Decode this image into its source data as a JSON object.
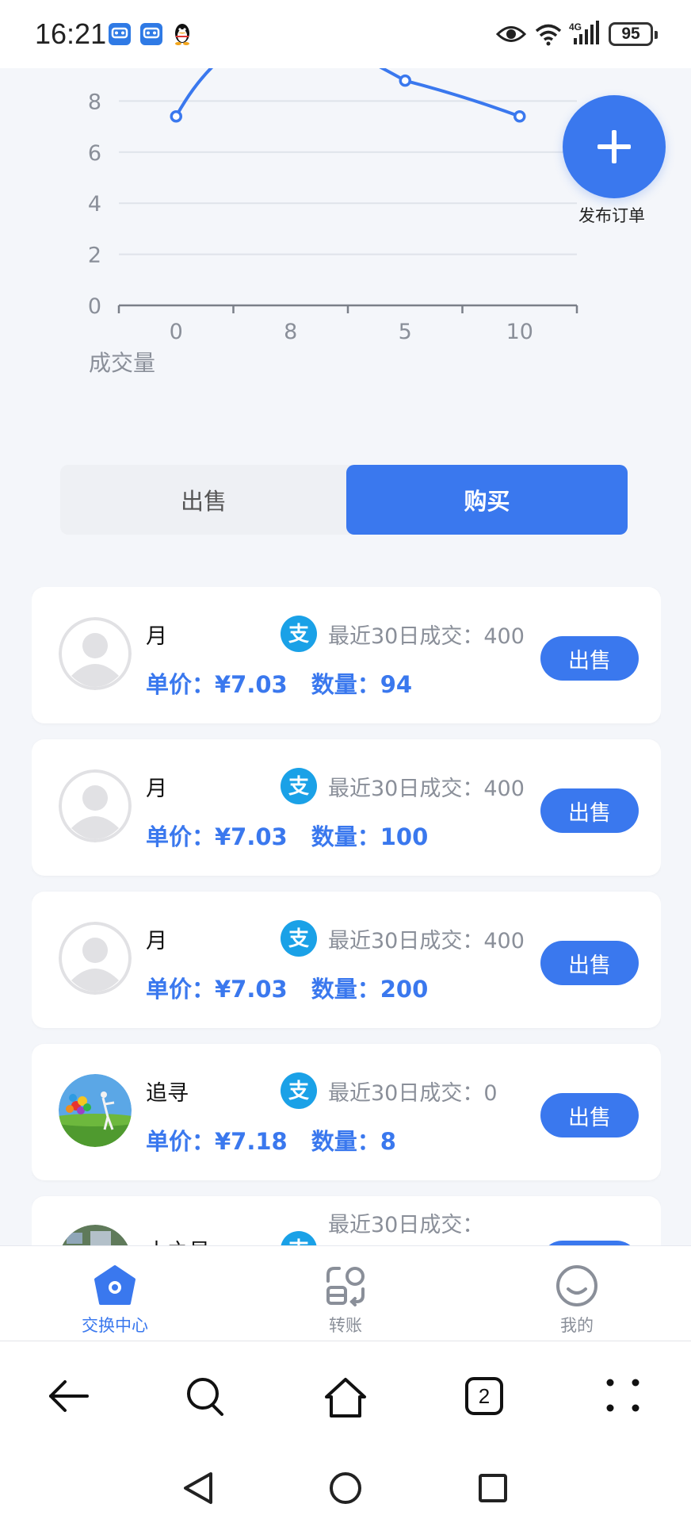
{
  "status_bar": {
    "time": "16:21",
    "battery": "95",
    "network": "4G",
    "icons": [
      "app-icon",
      "app-icon",
      "qq-penguin-icon",
      "eye-icon",
      "wifi-icon",
      "signal-icon",
      "battery-icon"
    ]
  },
  "chart_data": {
    "type": "line",
    "xlabel": "成交量",
    "categories": [
      "0",
      "8",
      "5",
      "10"
    ],
    "y_ticks": [
      "0",
      "2",
      "4",
      "6",
      "8"
    ],
    "ylim": [
      0,
      8
    ],
    "visible_points": [
      {
        "x_index": 0,
        "y": 7.4
      },
      {
        "x_index": 2,
        "y": 8.8
      },
      {
        "x_index": 3,
        "y": 7.4
      }
    ],
    "series_color": "#3a78ee",
    "grid": true
  },
  "publish": {
    "label": "发布订单",
    "icon": "plus-icon"
  },
  "tabs": [
    {
      "label": "出售",
      "active": false
    },
    {
      "label": "购买",
      "active": true
    }
  ],
  "orders": [
    {
      "name": "月",
      "recent": "最近30日成交：400",
      "price": "单价：¥7.03",
      "qty": "数量：94",
      "action": "出售",
      "avatar": "default-avatar"
    },
    {
      "name": "月",
      "recent": "最近30日成交：400",
      "price": "单价：¥7.03",
      "qty": "数量：100",
      "action": "出售",
      "avatar": "default-avatar"
    },
    {
      "name": "月",
      "recent": "最近30日成交：400",
      "price": "单价：¥7.03",
      "qty": "数量：200",
      "action": "出售",
      "avatar": "default-avatar"
    },
    {
      "name": "追寻",
      "recent": "最近30日成交：0",
      "price": "单价：¥7.18",
      "qty": "数量：8",
      "action": "出售",
      "avatar": "balloon-photo"
    },
    {
      "name": "木之易",
      "recent": "最近30日成交：",
      "price": "",
      "qty": "",
      "action": "出售",
      "avatar": "aerial-photo"
    }
  ],
  "bottom_nav": [
    {
      "label": "交换中心",
      "icon": "exchange-center-icon",
      "active": true
    },
    {
      "label": "转账",
      "icon": "transfer-icon",
      "active": false
    },
    {
      "label": "我的",
      "icon": "smile-icon",
      "active": false
    }
  ],
  "browser_bar": {
    "tab_count": "2",
    "icons": [
      "back-arrow-icon",
      "search-icon",
      "home-icon",
      "tabs-icon",
      "more-dots-icon"
    ]
  },
  "colors": {
    "accent": "#3a78ee",
    "alipay": "#1aa1e7",
    "background": "#f4f6fa"
  }
}
